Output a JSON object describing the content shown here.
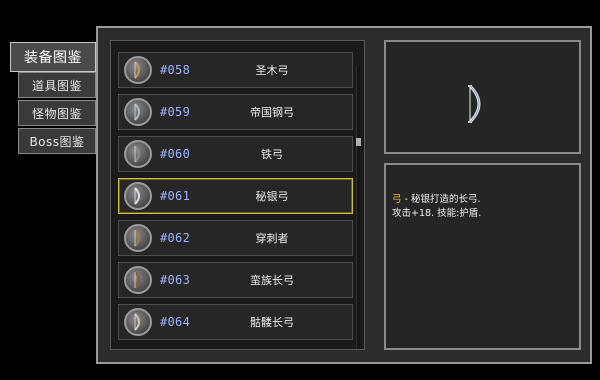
{
  "tabs": [
    {
      "label": "装备图鉴",
      "active": true
    },
    {
      "label": "道具图鉴",
      "active": false
    },
    {
      "label": "怪物图鉴",
      "active": false
    },
    {
      "label": "Boss图鉴",
      "active": false
    }
  ],
  "items": [
    {
      "id": "#058",
      "name": "圣木弓",
      "selected": false,
      "icon": "bow-icon"
    },
    {
      "id": "#059",
      "name": "帝国钢弓",
      "selected": false,
      "icon": "bow-icon"
    },
    {
      "id": "#060",
      "name": "铁弓",
      "selected": false,
      "icon": "bow-icon"
    },
    {
      "id": "#061",
      "name": "秘银弓",
      "selected": true,
      "icon": "bow-icon"
    },
    {
      "id": "#062",
      "name": "穿刺者",
      "selected": false,
      "icon": "bow-icon"
    },
    {
      "id": "#063",
      "name": "蛮族长弓",
      "selected": false,
      "icon": "bow-icon"
    },
    {
      "id": "#064",
      "name": "骷髅长弓",
      "selected": false,
      "icon": "bow-icon"
    }
  ],
  "detail": {
    "type_keyword": "弓",
    "line1_rest": " - 秘银打造的长弓.",
    "line2": "攻击+18. 技能:护盾.",
    "preview_icon": "mithril-bow-icon"
  },
  "colors": {
    "id_text": "#9fb2ff",
    "keyword": "#f0c23a",
    "selected_border": "#c8c24a"
  }
}
